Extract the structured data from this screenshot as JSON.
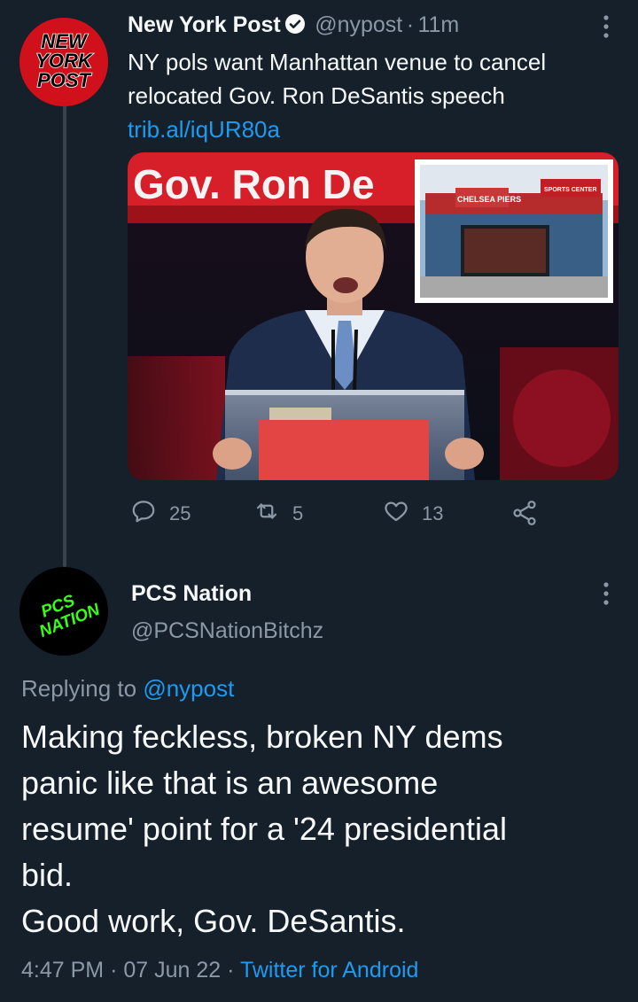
{
  "tweet": {
    "author_name": "New York Post",
    "author_handle": "@nypost",
    "separator": "·",
    "time_ago": "11m",
    "text": "NY pols want Manhattan venue to cancel relocated Gov. Ron DeSantis speech ",
    "link_text": "trib.al/iqUR80a",
    "media": {
      "banner_text": "Gov. Ron De",
      "inset_sign_1": "CHELSEA PIERS",
      "inset_sign_2": "SPORTS CENTER"
    },
    "stats": {
      "replies": "25",
      "retweets": "5",
      "likes": "13"
    },
    "avatar_logo": [
      "NEW",
      "YORK",
      "POST"
    ]
  },
  "reply": {
    "author_name": "PCS Nation",
    "author_handle": "@PCSNationBitchz",
    "replying_prefix": "Replying to ",
    "replying_to": "@nypost",
    "text_lines": [
      "Making feckless, broken NY dems",
      "panic like that is an awesome",
      "resume' point for a '24 presidential",
      "bid.",
      "Good work, Gov. DeSantis."
    ],
    "time": "4:47 PM",
    "date": "07 Jun 22",
    "separator": "·",
    "source": "Twitter for Android",
    "avatar_logo": [
      "PCS",
      "NATION"
    ]
  },
  "colors": {
    "background": "#15202b",
    "accent": "#1d9bf0",
    "secondary_text": "#8b98a5",
    "nypost_red": "#d0101a",
    "pcs_green": "#39ff14"
  },
  "icons": [
    "verified-badge-icon",
    "more-icon",
    "reply-icon",
    "retweet-icon",
    "like-icon",
    "share-icon"
  ]
}
